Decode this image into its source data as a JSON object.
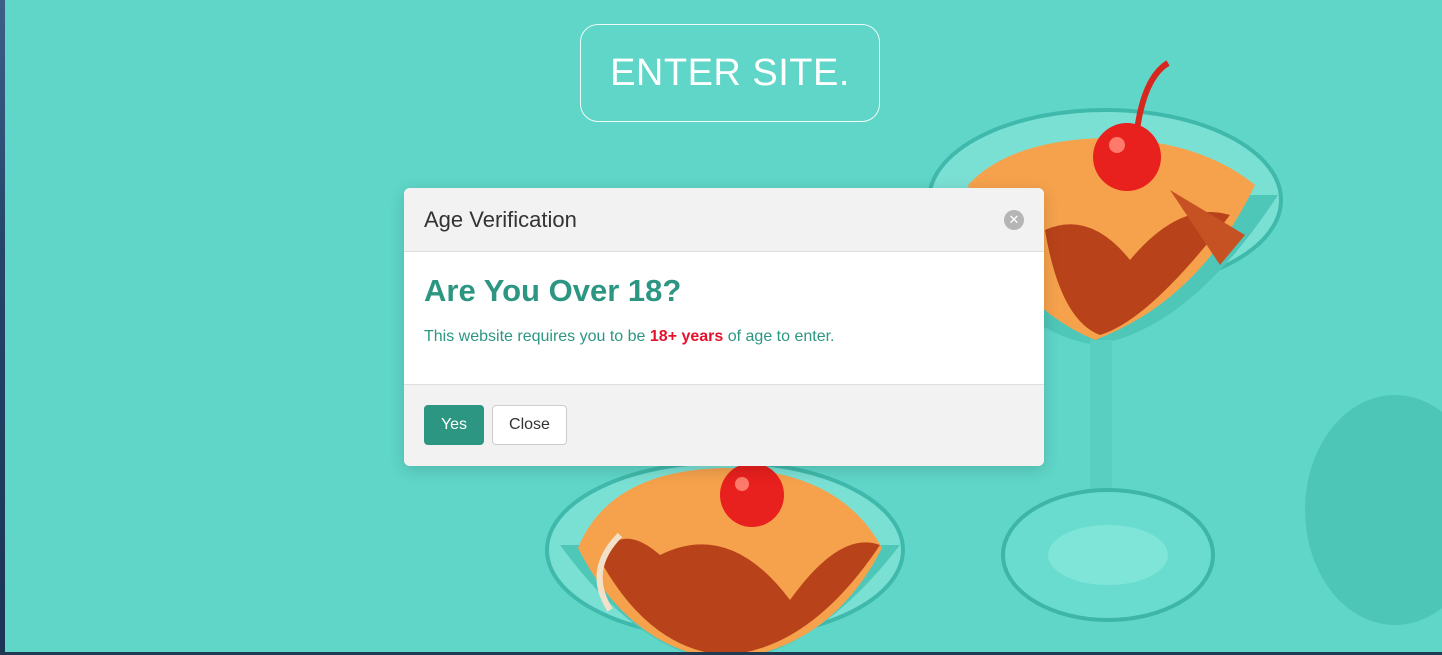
{
  "enter_button": {
    "label": "ENTER SITE."
  },
  "modal": {
    "title": "Age Verification",
    "close_icon": "close-icon",
    "heading": "Are You Over 18?",
    "message_before": "This website requires you to be ",
    "message_highlight": "18+ years",
    "message_after": " of age to enter.",
    "yes_label": "Yes",
    "close_label": "Close"
  },
  "colors": {
    "background": "#5fd6c8",
    "accent": "#2c9682",
    "highlight": "#e8112d",
    "drink": "#f5a04a",
    "cherry": "#e8201e"
  }
}
